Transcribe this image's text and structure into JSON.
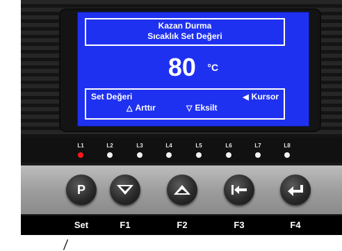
{
  "display": {
    "title_line1": "Kazan Durma",
    "title_line2": "Sıcaklık Set Değeri",
    "value": "80",
    "unit": "°C",
    "footer_left": "Set Değeri",
    "footer_right": "Kursor",
    "footer_up": "Arttır",
    "footer_down": "Eksilt"
  },
  "leds": [
    {
      "label": "L1",
      "state": "on"
    },
    {
      "label": "L2",
      "state": "off"
    },
    {
      "label": "L3",
      "state": "off"
    },
    {
      "label": "L4",
      "state": "off"
    },
    {
      "label": "L5",
      "state": "off"
    },
    {
      "label": "L6",
      "state": "off"
    },
    {
      "label": "L7",
      "state": "off"
    },
    {
      "label": "L8",
      "state": "off"
    }
  ],
  "keys": {
    "p_label": "P",
    "set_label": "Set",
    "f1_label": "F1",
    "f2_label": "F2",
    "f3_label": "F3",
    "f4_label": "F4"
  },
  "icons": [
    "left-triangle-icon",
    "up-triangle-icon",
    "down-triangle-icon",
    "chevron-down-icon",
    "chevron-up-icon",
    "arrow-left-bar-icon",
    "enter-icon"
  ],
  "colors": {
    "lcd": "#1f31f0",
    "led_on": "#ff1a1a",
    "led_off": "#f2f2f2"
  }
}
